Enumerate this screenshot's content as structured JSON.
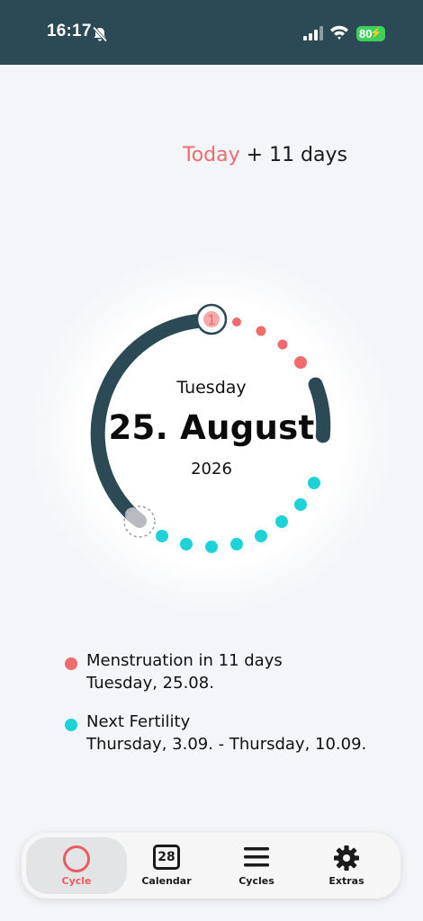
{
  "status_bar": {
    "time": "16:17",
    "battery_level": "80"
  },
  "header": {
    "today_label": "Today",
    "offset_label": "+ 11 days"
  },
  "cycle_ring": {
    "current_day_marker": "1",
    "weekday": "Tuesday",
    "date": "25. August",
    "year": "2026",
    "colors": {
      "ring": "#2b4a55",
      "menstruation": "#f06a6e",
      "fertility": "#1dd3d8"
    }
  },
  "info": {
    "menstruation": {
      "title": "Menstruation in 11 days",
      "date": "Tuesday, 25.08."
    },
    "fertility": {
      "title": "Next Fertility",
      "range": "Thursday, 3.09. - Thursday, 10.09."
    }
  },
  "tabbar": {
    "tabs": [
      {
        "label": "Cycle",
        "icon": "ring-icon",
        "active": true
      },
      {
        "label": "Calendar",
        "icon": "calendar-icon",
        "badge": "28",
        "active": false
      },
      {
        "label": "Cycles",
        "icon": "menu-lines-icon",
        "active": false
      },
      {
        "label": "Extras",
        "icon": "gear-icon",
        "active": false
      }
    ]
  }
}
